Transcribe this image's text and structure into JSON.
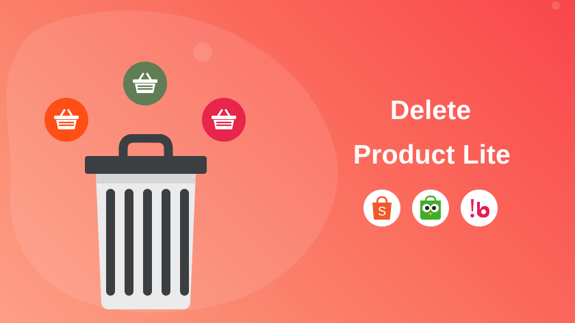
{
  "title": {
    "line1": "Delete",
    "line2": "Product Lite"
  },
  "baskets": [
    {
      "name": "orange-basket",
      "color": "#ff4e16"
    },
    {
      "name": "green-basket",
      "color": "#607d55"
    },
    {
      "name": "pink-basket",
      "color": "#e8254a"
    }
  ],
  "marketplace_logos": [
    {
      "name": "shopee",
      "letter": "S",
      "color": "#f05a2b"
    },
    {
      "name": "tokopedia",
      "color": "#3fae2a"
    },
    {
      "name": "bukalapak",
      "color": "#e31e52"
    }
  ],
  "colors": {
    "background_start": "#f9464a",
    "background_end": "#fd9f86",
    "trash_dark": "#3b3f42",
    "trash_light": "#ebebeb",
    "text": "#ffffff"
  }
}
